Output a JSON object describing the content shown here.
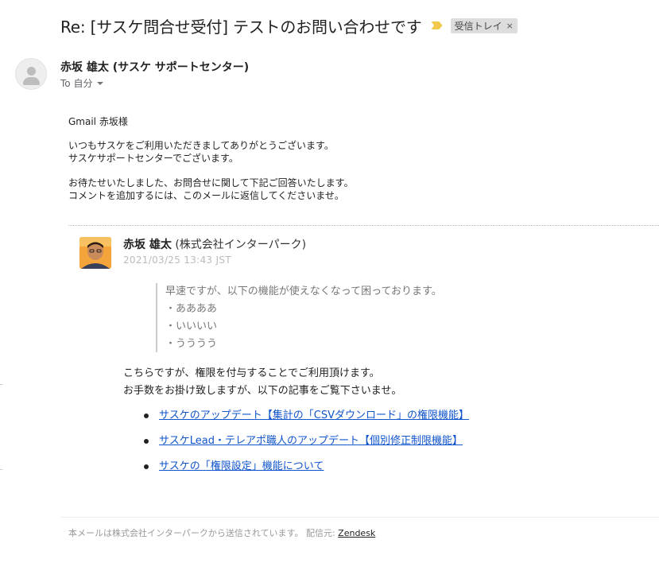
{
  "subject": {
    "title": "Re: [サスケ問合せ受付] テストのお問い合わせです",
    "label": "受信トレイ",
    "label_close": "×"
  },
  "sender": {
    "name": "赤坂 雄太 (サスケ サポートセンター)",
    "to_label": "To 自分"
  },
  "intro": {
    "greeting": "Gmail 赤坂様",
    "line1": "いつもサスケをご利用いただきましてありがとうございます。",
    "line2": "サスケサポートセンターでございます。",
    "line3": "お待たせいたしました、お問合せに関して下記ご回答いたします。",
    "line4": "コメントを追加するには、このメールに返信してくださいませ。"
  },
  "comment": {
    "author_name": "赤坂 雄太",
    "author_company": "(株式会社インターパーク)",
    "date": "2021/03/25 13:43 JST",
    "quote": [
      "早速ですが、以下の機能が使えなくなって困っております。",
      "・ああああ",
      "・いいいい",
      "・うううう"
    ],
    "reply_line1": "こちらですが、権限を付与することでご利用頂けます。",
    "reply_line2": "お手数をお掛け致しますが、以下の記事をご覧下さいませ。",
    "links": [
      "サスケのアップデート【集計の「CSVダウンロード」の権限機能】",
      "サスケLead・テレアポ職人のアップデート【個別修正制限機能】",
      "サスケの「権限設定」機能について"
    ]
  },
  "footer": {
    "text": "本メールは株式会社インターパークから送信されています。 配信元:",
    "link": "Zendesk"
  },
  "colors": {
    "link": "#1155cc",
    "importance": "#f2c94c",
    "label_chip": "#dddddd"
  }
}
